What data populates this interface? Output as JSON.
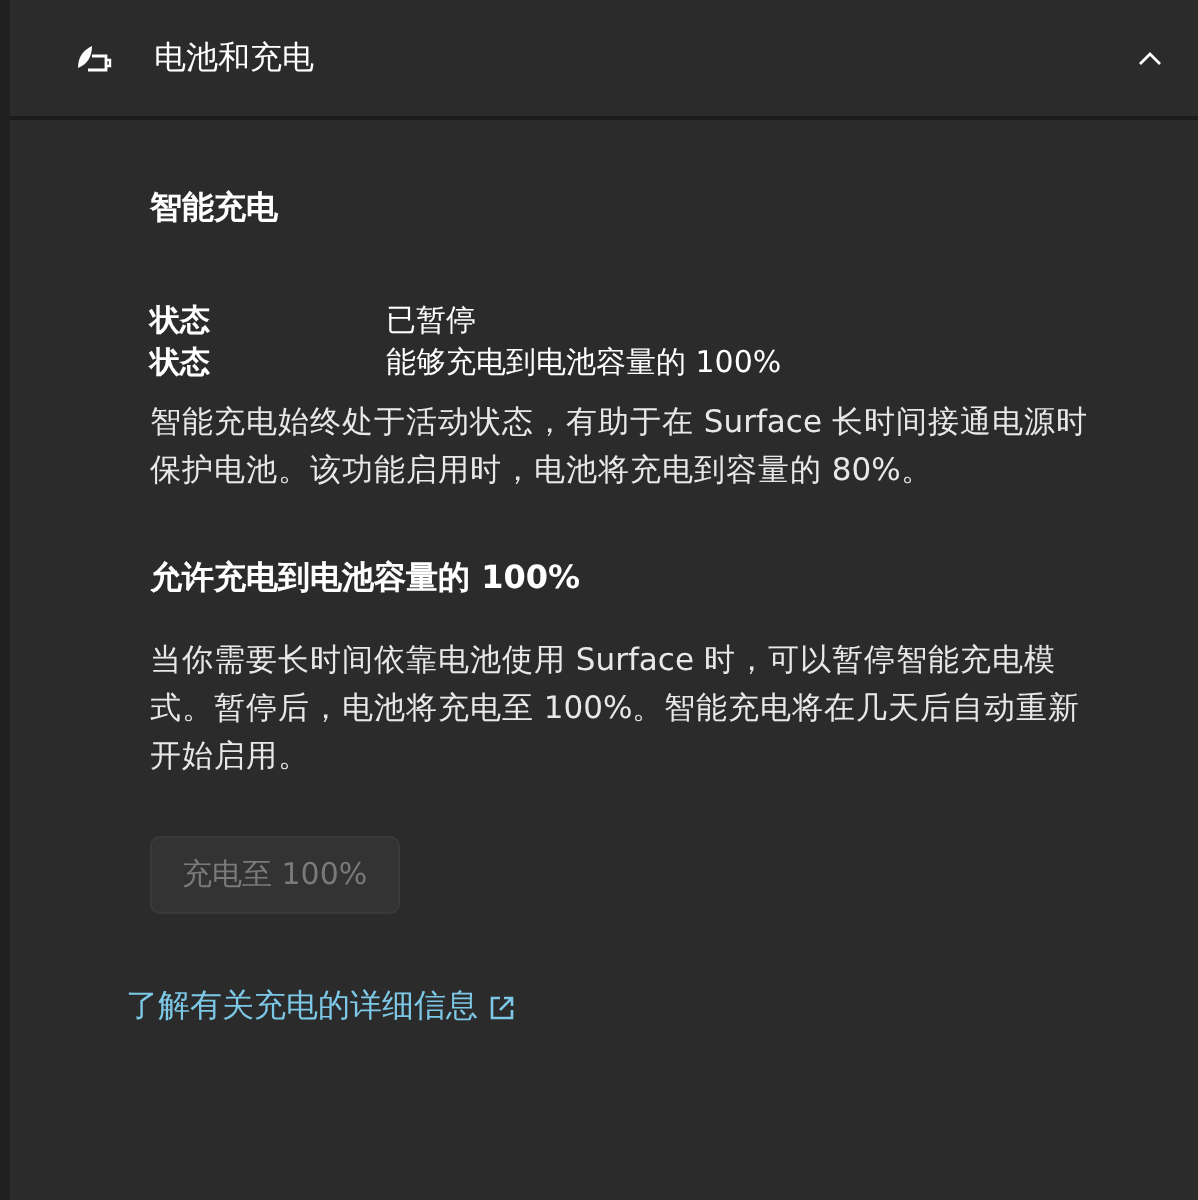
{
  "header": {
    "title": "电池和充电",
    "expanded": true
  },
  "section": {
    "title": "智能充电",
    "status_rows": [
      {
        "label": "状态",
        "value": "已暂停"
      },
      {
        "label": "状态",
        "value": "能够充电到电池容量的 100%"
      }
    ],
    "description": "智能充电始终处于活动状态，有助于在 Surface 长时间接通电源时保护电池。该功能启用时，电池将充电到容量的 80%。"
  },
  "override": {
    "title": "允许充电到电池容量的 100%",
    "description": "当你需要长时间依靠电池使用 Surface 时，可以暂停智能充电模式。暂停后，电池将充电至 100%。智能充电将在几天后自动重新开始启用。",
    "button": {
      "label": "充电至 100%",
      "disabled": true
    }
  },
  "link": "了解有关充电的详细信息"
}
